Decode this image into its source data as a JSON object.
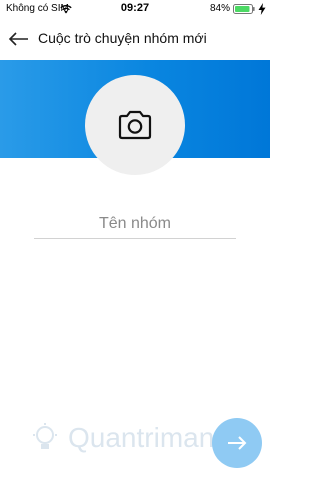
{
  "status_bar": {
    "carrier": "Không có SIM",
    "time": "09:27",
    "battery": "84%"
  },
  "header": {
    "title": "Cuộc trò chuyện nhóm mới"
  },
  "group_name": {
    "placeholder": "Tên nhóm",
    "value": ""
  },
  "watermark": {
    "text": "Quantrimang"
  },
  "colors": {
    "banner_blue": "#0a86e0",
    "fab_blue": "#8fcaf3",
    "avatar_bg": "#efefef"
  },
  "icons": {
    "back": "arrow-left-icon",
    "photo": "camera-icon",
    "next": "arrow-right-icon"
  }
}
